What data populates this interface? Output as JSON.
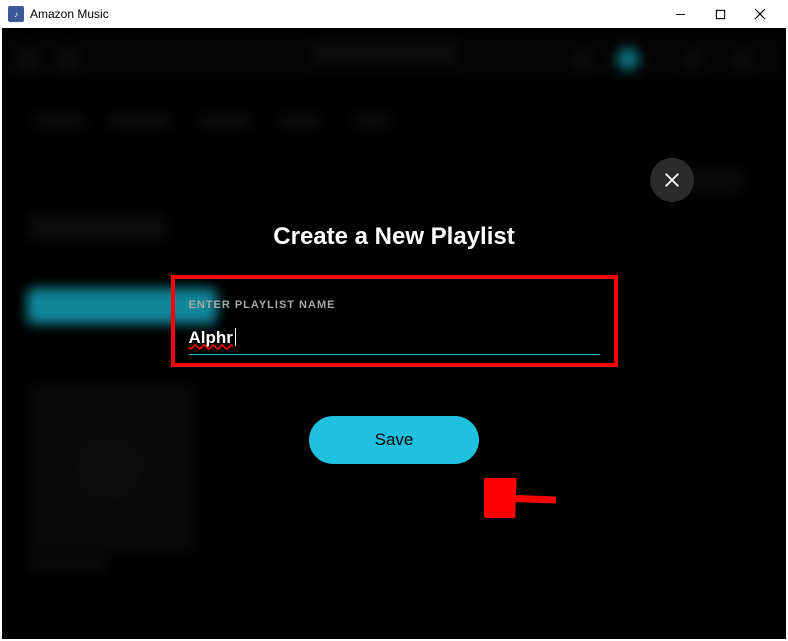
{
  "window": {
    "title": "Amazon Music"
  },
  "modal": {
    "title": "Create a New Playlist",
    "input_label": "ENTER PLAYLIST NAME",
    "input_value": "Alphr",
    "save_label": "Save"
  }
}
